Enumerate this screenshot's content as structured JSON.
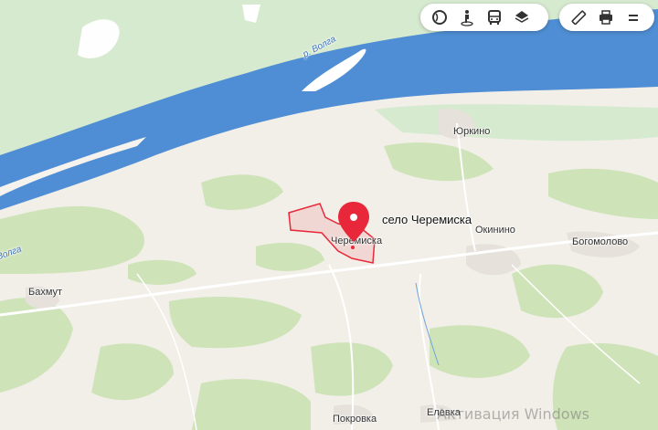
{
  "map": {
    "river_labels": [
      "р. Волга",
      "Волга"
    ],
    "places": {
      "yurkino": "Юркино",
      "okinino": "Окинино",
      "bogomolovo": "Богомолово",
      "bakhmut": "Бахмут",
      "pokrovka": "Покровка",
      "elevka": "Елевка",
      "cheremiska": "Черемиска"
    },
    "search_result": {
      "label": "село Черемиска"
    },
    "colors": {
      "water": "#4f8ed4",
      "land": "#f2efe9",
      "forest": "#cfe3b9",
      "meadow": "#d8ecd2",
      "highlight": "#e8283a",
      "road": "#ffffff"
    }
  },
  "toolbar_left": {
    "buttons": [
      {
        "icon": "panorama-icon",
        "label": "Панорамы"
      },
      {
        "icon": "street-view-icon",
        "label": "Люди"
      },
      {
        "icon": "bus-icon",
        "label": "Транспорт"
      },
      {
        "icon": "layers-icon",
        "label": "Слои"
      }
    ]
  },
  "toolbar_right": {
    "buttons": [
      {
        "icon": "ruler-icon",
        "label": "Линейка"
      },
      {
        "icon": "print-icon",
        "label": "Печать"
      },
      {
        "icon": "menu-icon",
        "label": "Меню"
      }
    ]
  },
  "watermark": "Активация Windows"
}
